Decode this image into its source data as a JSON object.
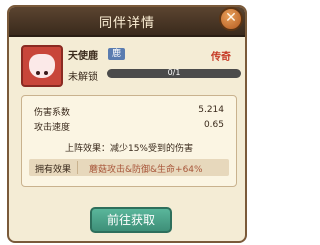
{
  "dialog": {
    "title": "同伴详情"
  },
  "close": {
    "icon": "close-icon",
    "symbol": "✕"
  },
  "companion": {
    "name": "天使鹿",
    "tag": "鹿",
    "rarity": "传奇",
    "status": "未解锁",
    "progress": {
      "current": 0,
      "total": 1,
      "label": "0/1"
    }
  },
  "stats": [
    {
      "label": "伤害系数",
      "value": "5.214"
    },
    {
      "label": "攻击速度",
      "value": "0.65"
    }
  ],
  "skill": {
    "text": "上阵效果：减少15%受到的伤害"
  },
  "owned": {
    "label": "拥有效果",
    "value": "蘑菇攻击&防御&生命+64%"
  },
  "action": {
    "label": "前往获取"
  },
  "colors": {
    "rarity": "#c63a26",
    "button": "#4aa38a",
    "panel": "#f4ecd5",
    "tag": "#5a7cb0"
  }
}
